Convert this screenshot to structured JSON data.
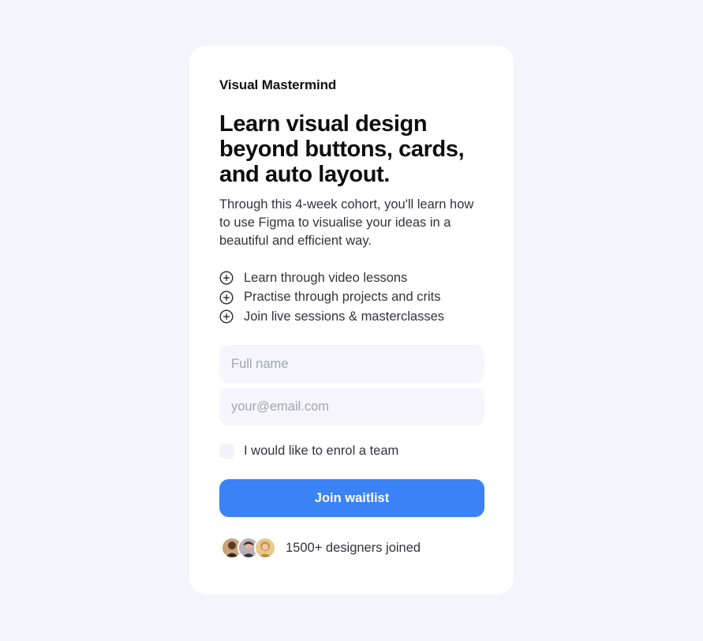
{
  "card": {
    "brand": "Visual Mastermind",
    "headline": "Learn visual design beyond buttons, cards, and auto layout.",
    "description": "Through this 4-week cohort, you'll learn how to use Figma to visualise your ideas in a beautiful and efficient way.",
    "features": [
      {
        "icon": "plus-circle-icon",
        "label": "Learn through video lessons"
      },
      {
        "icon": "plus-circle-icon",
        "label": "Practise through projects and crits"
      },
      {
        "icon": "plus-circle-icon",
        "label": "Join live sessions & masterclasses"
      }
    ],
    "form": {
      "name_placeholder": "Full name",
      "name_value": "",
      "email_placeholder": "your@email.com",
      "email_value": "",
      "team_checkbox_label": "I would like to enrol a team",
      "team_checked": false,
      "submit_label": "Join waitlist"
    },
    "social_proof": {
      "text": "1500+ designers joined",
      "avatars": [
        "avatar-1",
        "avatar-2",
        "avatar-3"
      ]
    }
  },
  "colors": {
    "page_background": "#f4f5fb",
    "card_background": "#ffffff",
    "accent": "#3b82f6",
    "input_background": "#f5f5fb"
  }
}
